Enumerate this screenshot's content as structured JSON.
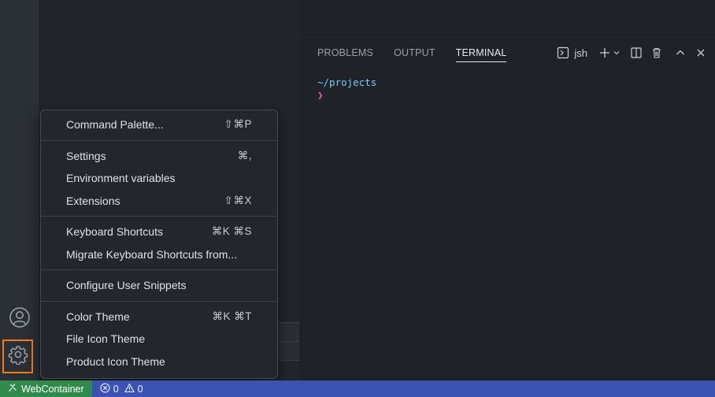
{
  "panel": {
    "tabs": [
      "PROBLEMS",
      "OUTPUT",
      "TERMINAL"
    ],
    "active_tab": "TERMINAL",
    "terminal_profile": "jsh"
  },
  "terminal": {
    "cwd": "~/projects",
    "prompt_symbol": "❯"
  },
  "menu": {
    "command_palette": {
      "label": "Command Palette...",
      "shortcut": "⇧⌘P"
    },
    "settings": {
      "label": "Settings",
      "shortcut": "⌘,"
    },
    "env_vars": {
      "label": "Environment variables",
      "shortcut": ""
    },
    "extensions": {
      "label": "Extensions",
      "shortcut": "⇧⌘X"
    },
    "keyboard_shortcuts": {
      "label": "Keyboard Shortcuts",
      "shortcut": "⌘K ⌘S"
    },
    "migrate_shortcuts": {
      "label": "Migrate Keyboard Shortcuts from...",
      "shortcut": ""
    },
    "user_snippets": {
      "label": "Configure User Snippets",
      "shortcut": ""
    },
    "color_theme": {
      "label": "Color Theme",
      "shortcut": "⌘K ⌘T"
    },
    "file_icon_theme": {
      "label": "File Icon Theme",
      "shortcut": ""
    },
    "product_icon_theme": {
      "label": "Product Icon Theme",
      "shortcut": ""
    }
  },
  "statusbar": {
    "remote_label": "WebContainer",
    "errors": "0",
    "warnings": "0"
  },
  "colors": {
    "accent_highlight": "#f27c1e",
    "statusbar_bg": "#3a53b3",
    "remote_bg": "#2f8a4b"
  }
}
